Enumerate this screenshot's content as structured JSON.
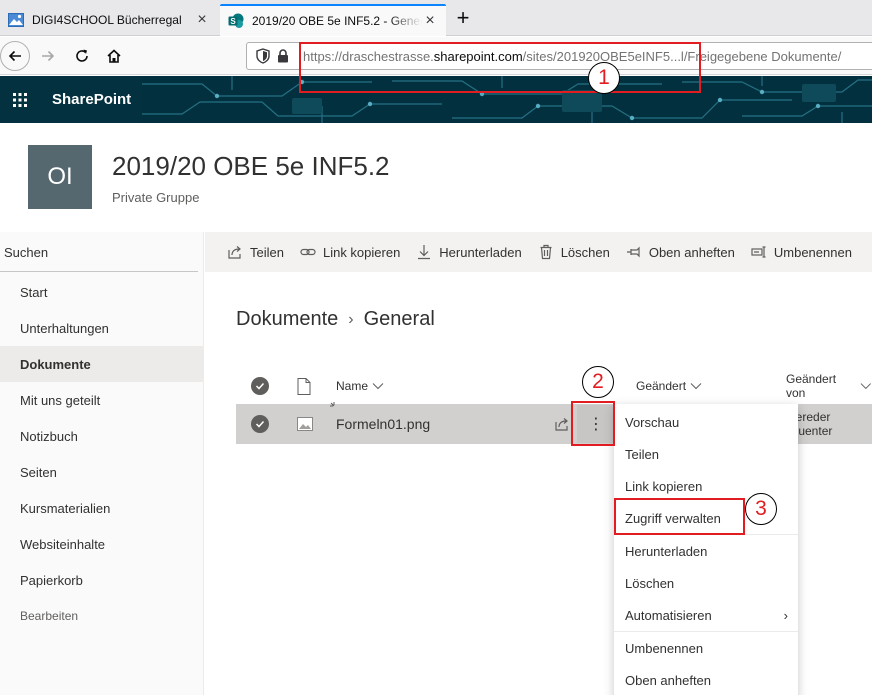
{
  "browser": {
    "tabs": [
      {
        "title": "DIGI4SCHOOL Bücherregal",
        "active": false,
        "close": "×"
      },
      {
        "title": "2019/20 OBE 5e INF5.2 - General - Alle Dokumente",
        "active": true,
        "close": "×"
      }
    ],
    "new_tab": "+",
    "url": {
      "prefix": "https://draschestrasse.",
      "domain": "sharepoint.com",
      "suffix": "/sites/201920OBE5eINF5...l/Freigegebene Dokumente/"
    }
  },
  "suite": {
    "brand": "SharePoint"
  },
  "site": {
    "logo_initials": "OI",
    "title": "2019/20 OBE 5e INF5.2",
    "subtitle": "Private Gruppe"
  },
  "leftnav": {
    "search": "Suchen",
    "items": [
      {
        "label": "Start"
      },
      {
        "label": "Unterhaltungen"
      },
      {
        "label": "Dokumente",
        "selected": true
      },
      {
        "label": "Mit uns geteilt"
      },
      {
        "label": "Notizbuch"
      },
      {
        "label": "Seiten"
      },
      {
        "label": "Kursmaterialien"
      },
      {
        "label": "Websiteinhalte"
      },
      {
        "label": "Papierkorb"
      }
    ],
    "edit": "Bearbeiten"
  },
  "commands": {
    "share": "Teilen",
    "copy_link": "Link kopieren",
    "download": "Herunterladen",
    "delete": "Löschen",
    "pin": "Oben anheften",
    "rename": "Umbenennen"
  },
  "breadcrumb": {
    "root": "Dokumente",
    "sep": "›",
    "current": "General"
  },
  "list": {
    "columns": {
      "name": "Name",
      "modified": "Geändert",
      "modified_by": "Geändert von"
    },
    "rows": [
      {
        "name": "Formeln01.png",
        "modified_by": "bereder Guenter"
      }
    ],
    "more_icon": "⋮"
  },
  "context_menu": {
    "items": [
      "Vorschau",
      "Teilen",
      "Link kopieren",
      "Zugriff verwalten",
      "Herunterladen",
      "Löschen",
      "Automatisieren",
      "Umbenennen",
      "Oben anheften"
    ],
    "submenu_chevron": "›"
  },
  "annotations": {
    "n1": "1",
    "n2": "2",
    "n3": "3"
  },
  "colors": {
    "annotation": "#e11d21",
    "suite_bar": "#032d3c",
    "accent": "#0a84ff"
  }
}
